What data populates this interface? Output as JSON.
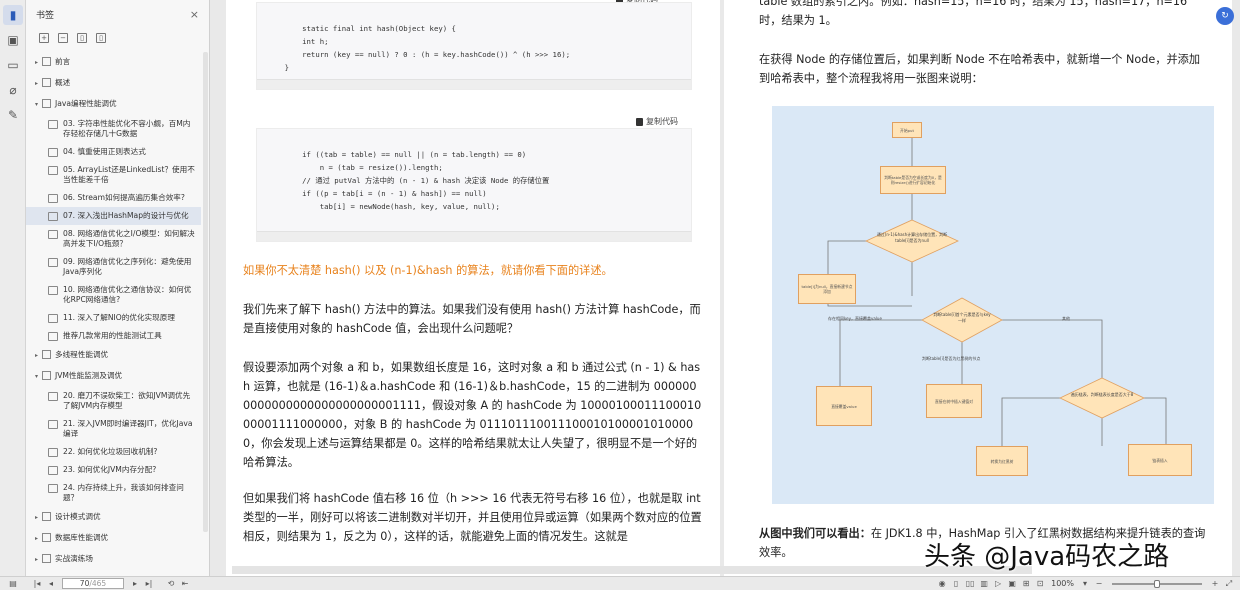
{
  "panel": {
    "title": "书签",
    "close_label": "×"
  },
  "tree": {
    "items": [
      {
        "kind": "node",
        "label": "前言"
      },
      {
        "kind": "node",
        "label": "概述"
      },
      {
        "kind": "node",
        "label": "Java编程性能调优"
      },
      {
        "kind": "child",
        "label": "03. 字符串性能优化不容小觑，百M内存轻松存储几十G数据"
      },
      {
        "kind": "child",
        "label": "04. 慎重使用正则表达式"
      },
      {
        "kind": "child",
        "label": "05. ArrayList还是LinkedList？使用不当性能差千倍"
      },
      {
        "kind": "child",
        "label": "06. Stream如何提高遍历集合效率?"
      },
      {
        "kind": "child",
        "label": "07. 深入浅出HashMap的设计与优化",
        "selected": true
      },
      {
        "kind": "child",
        "label": "08. 网络通信优化之I/O模型：如何解决高并发下I/O瓶颈？"
      },
      {
        "kind": "child",
        "label": "09. 网络通信优化之序列化：避免使用Java序列化"
      },
      {
        "kind": "child",
        "label": "10. 网络通信优化之通信协议：如何优化RPC网络通信?"
      },
      {
        "kind": "child",
        "label": "11. 深入了解NIO的优化实现原理"
      },
      {
        "kind": "child",
        "label": "推荐几款常用的性能测试工具"
      },
      {
        "kind": "node",
        "label": "多线程性能调优"
      },
      {
        "kind": "node",
        "label": "JVM性能监测及调优"
      },
      {
        "kind": "child",
        "label": "20. 磨刀不误砍柴工：欲知JVM调优先了解JVM内存模型"
      },
      {
        "kind": "child",
        "label": "21. 深入JVM即时编译器JIT，优化Java编译"
      },
      {
        "kind": "child",
        "label": "22. 如何优化垃圾回收机制?"
      },
      {
        "kind": "child",
        "label": "23. 如何优化JVM内存分配?"
      },
      {
        "kind": "child",
        "label": "24. 内存持续上升，我该如何排查问题？"
      },
      {
        "kind": "node",
        "label": "设计模式调优"
      },
      {
        "kind": "node",
        "label": "数据库性能调优"
      },
      {
        "kind": "node",
        "label": "实战演练场"
      }
    ]
  },
  "leftpage": {
    "code1": "static final int hash(Object key) {\n        int h;\n        return (key == null) ? 0 : (h = key.hashCode()) ^ (h >>> 16);\n    }",
    "copy_label": "复制代码",
    "code2": "if ((tab = table) == null || (n = tab.length) == 0)\n            n = (tab = resize()).length;\n        // 通过 putVal 方法中的 (n - 1) & hash 决定该 Node 的存储位置\n        if ((p = tab[i = (n - 1) & hash]) == null)\n            tab[i] = newNode(hash, key, value, null);",
    "orange_note": "如果你不太清楚 hash() 以及 (n-1)&hash 的算法，就请你看下面的详述。",
    "p1": "我们先来了解下 hash() 方法中的算法。如果我们没有使用 hash() 方法计算 hashCode，而是直接使用对象的 hashCode 值，会出现什么问题呢？",
    "p2": "假设要添加两个对象 a 和 b，如果数组长度是 16，这时对象 a 和 b 通过公式 (n - 1) & hash 运算，也就是 (16-1)＆a.hashCode 和 (16-1)＆b.hashCode，15 的二进制为 0000000000000000000000000001111，假设对象 A 的 hashCode 为 1000010001110001000001111000000，对象 B 的 hashCode 为 0111011100111000101000010100000，你会发现上述与运算结果都是 0。这样的哈希结果就太让人失望了，很明显不是一个好的哈希算法。",
    "p3": "但如果我们将 hashCode 值右移 16 位（h >>> 16 代表无符号右移 16 位），也就是取 int 类型的一半，刚好可以将该二进制数对半切开，并且使用位异或运算（如果两个数对应的位置相反，则结果为 1，反之为 0），这样的话，就能避免上面的情况发生。这就是"
  },
  "rightpage": {
    "top_text": "table 数组的索引之内。例如：hash=15，n=16 时，结果为 15；hash=17，n=16 时，结果为 1。",
    "p1": "在获得 Node 的存储位置后，如果判断 Node 不在哈希表中，就新增一个 Node，并添加到哈希表中，整个流程我将用一张图来说明：",
    "bold_lead": "从图中我们可以看出：",
    "p2": "在 JDK1.8 中，HashMap 引入了红黑树数据结构来提升链表的查询效率。",
    "flow": {
      "start": "开始put",
      "step1": "判断table是否为空或长度为0，是则resize()进行扩容初始化",
      "dia1": "通过(n-1)&hash计算出存储位置，判断table[i]是否为null",
      "newnode": "table[i]为null，直接新建节点添加",
      "dia2": "判断table[i]首个元素是否与key一样",
      "label_same": "存在相同key，直接覆盖value",
      "label_else": "判断table[i]是否为红黑树的节点",
      "label_else2": "其他",
      "cover": "直接覆盖value",
      "tree_insert": "直接在树中插入键值对",
      "dia3": "遍历链表，判断链表长度是否大于8",
      "to_tree": "转换为红黑树",
      "list_insert": "链表插入"
    }
  },
  "status": {
    "page_current": "70",
    "page_total": "/465",
    "zoom": "100%"
  },
  "watermark": "头条 @Java码农之路"
}
